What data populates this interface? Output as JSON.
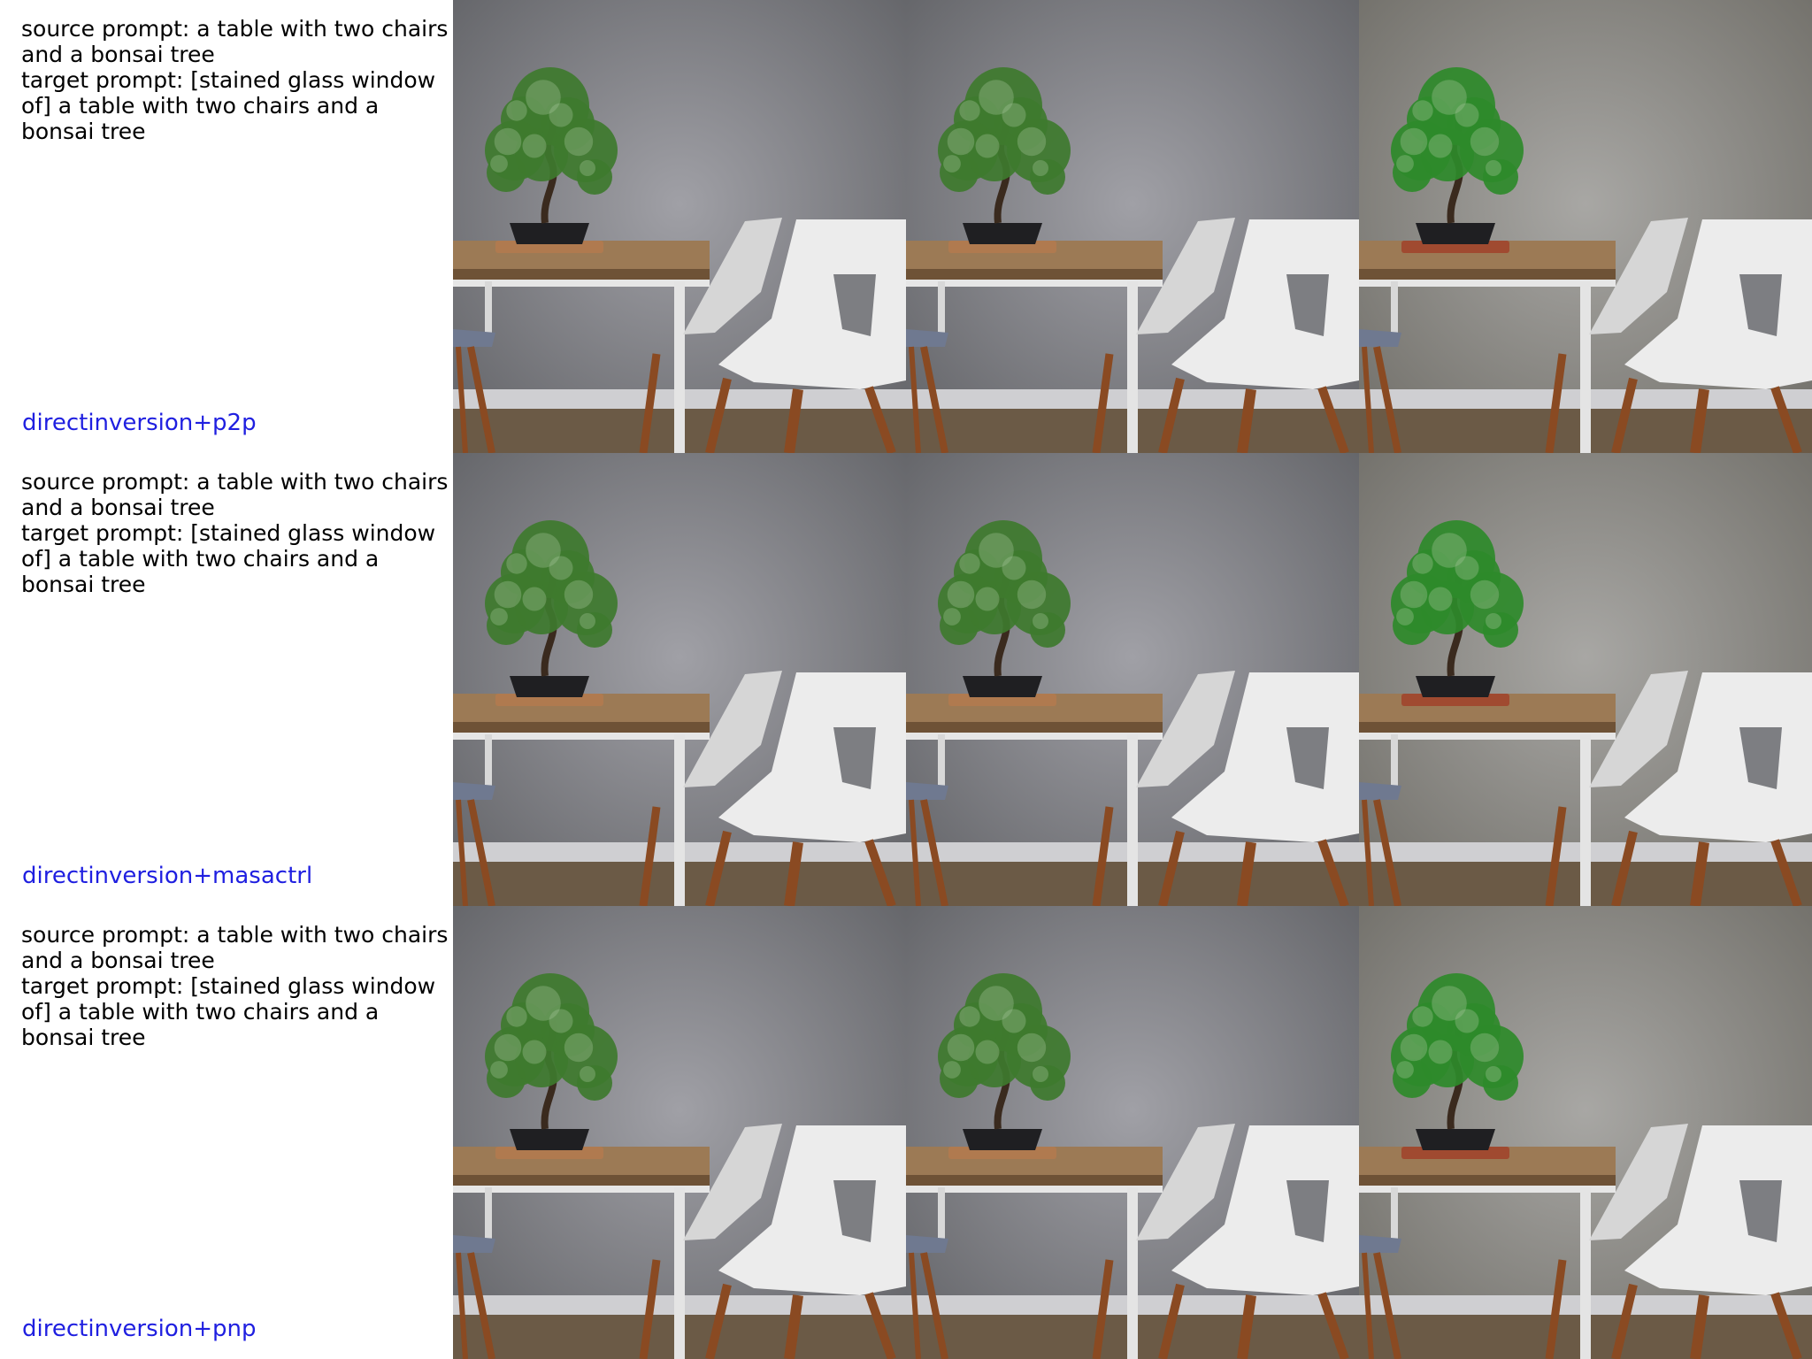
{
  "rows": [
    {
      "source_prompt": "source prompt: a table with two chairs\nand a bonsai tree",
      "target_prompt": "target prompt: [stained glass window\nof] a table with two chairs and a\nbonsai tree",
      "method": "directinversion+p2p"
    },
    {
      "source_prompt": "source prompt: a table with two chairs\nand a bonsai tree",
      "target_prompt": "target prompt: [stained glass window\nof] a table with two chairs and a\nbonsai tree",
      "method": "directinversion+masactrl"
    },
    {
      "source_prompt": "source prompt: a table with two chairs\nand a bonsai tree",
      "target_prompt": "target prompt: [stained glass window\nof] a table with two chairs and a\nbonsai tree",
      "method": "directinversion+pnp"
    }
  ],
  "images": {
    "scene": "photo of bonsai tree on wooden table with white chairs",
    "wall_color": "#8a8b90",
    "floor_color": "#6b5a46",
    "table_top_color": "#9c7a55",
    "chair_color": "#ececec",
    "leg_color": "#8a4a22",
    "foliage_color": "#3e7a2e"
  }
}
